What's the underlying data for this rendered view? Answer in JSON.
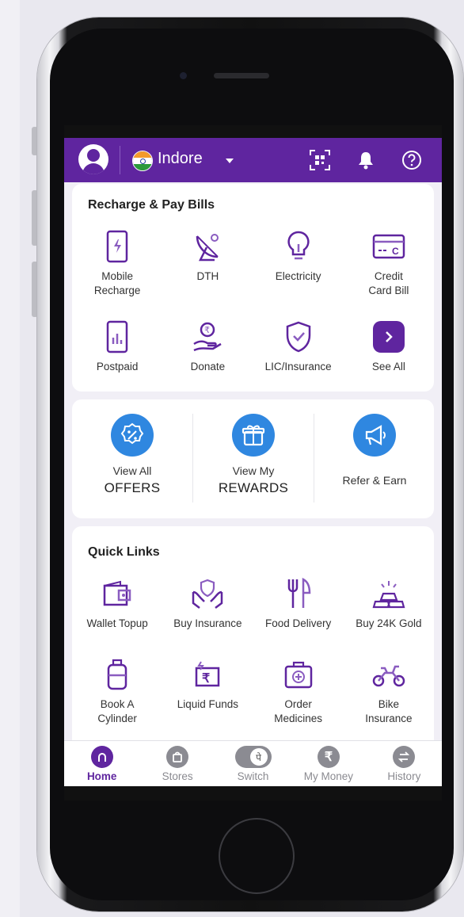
{
  "header": {
    "city": "Indore"
  },
  "recharge": {
    "title": "Recharge & Pay Bills",
    "items": [
      {
        "label": "Mobile\nRecharge",
        "icon": "mobile-recharge-icon"
      },
      {
        "label": "DTH",
        "icon": "satellite-dish-icon"
      },
      {
        "label": "Electricity",
        "icon": "bulb-icon"
      },
      {
        "label": "Credit\nCard Bill",
        "icon": "credit-card-icon"
      },
      {
        "label": "Postpaid",
        "icon": "postpaid-phone-icon"
      },
      {
        "label": "Donate",
        "icon": "donate-icon"
      },
      {
        "label": "LIC/Insurance",
        "icon": "shield-icon"
      },
      {
        "label": "See All",
        "icon": "chevron-right-icon"
      }
    ]
  },
  "promos": [
    {
      "line1": "View All",
      "line2": "OFFERS",
      "icon": "offers-icon"
    },
    {
      "line1": "View My",
      "line2": "REWARDS",
      "icon": "gift-icon"
    },
    {
      "line1": "Refer & Earn",
      "line2": "",
      "icon": "megaphone-icon"
    }
  ],
  "quick_links": {
    "title": "Quick Links",
    "items": [
      {
        "label": "Wallet Topup",
        "icon": "wallet-icon"
      },
      {
        "label": "Buy Insurance",
        "icon": "insurance-hands-icon"
      },
      {
        "label": "Food Delivery",
        "icon": "fork-knife-icon"
      },
      {
        "label": "Buy 24K Gold",
        "icon": "gold-bars-icon"
      },
      {
        "label": "Book A\nCylinder",
        "icon": "cylinder-icon"
      },
      {
        "label": "Liquid Funds",
        "icon": "rupee-funds-icon"
      },
      {
        "label": "Order\nMedicines",
        "icon": "medicine-kit-icon"
      },
      {
        "label": "Bike\nInsurance",
        "icon": "bike-icon"
      }
    ]
  },
  "nav": [
    {
      "label": "Home",
      "icon": "home-icon",
      "active": true
    },
    {
      "label": "Stores",
      "icon": "stores-icon"
    },
    {
      "label": "Switch",
      "icon": "switch-icon"
    },
    {
      "label": "My Money",
      "icon": "rupee-icon"
    },
    {
      "label": "History",
      "icon": "history-icon"
    }
  ],
  "colors": {
    "brand": "#5f259f",
    "promo_blue": "#2f87e0"
  }
}
